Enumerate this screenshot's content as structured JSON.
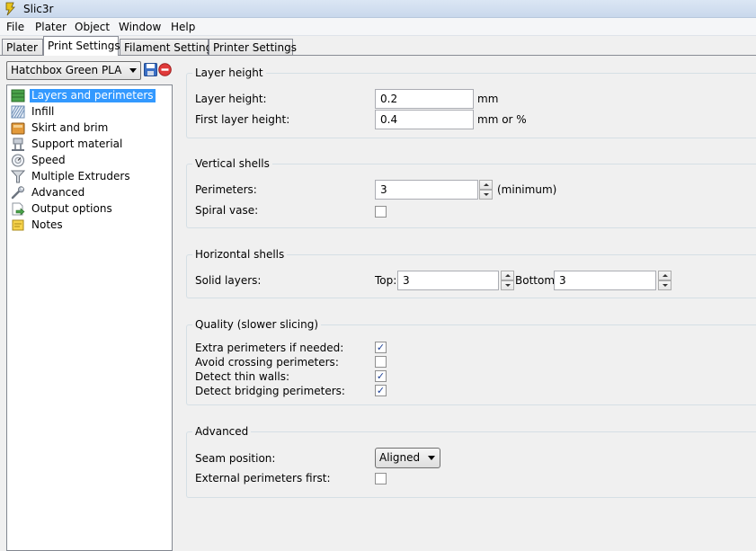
{
  "window": {
    "title": "Slic3r"
  },
  "menu": [
    "File",
    "Plater",
    "Object",
    "Window",
    "Help"
  ],
  "tabs": [
    "Plater",
    "Print Settings",
    "Filament Settings",
    "Printer Settings"
  ],
  "active_tab": "Print Settings",
  "preset": {
    "selected": "Hatchbox Green PLA"
  },
  "tree": {
    "items": [
      {
        "label": "Layers and perimeters",
        "icon": "layers-icon"
      },
      {
        "label": "Infill",
        "icon": "infill-icon"
      },
      {
        "label": "Skirt and brim",
        "icon": "skirt-icon"
      },
      {
        "label": "Support material",
        "icon": "support-icon"
      },
      {
        "label": "Speed",
        "icon": "speed-icon"
      },
      {
        "label": "Multiple Extruders",
        "icon": "funnel-icon"
      },
      {
        "label": "Advanced",
        "icon": "wrench-icon"
      },
      {
        "label": "Output options",
        "icon": "output-icon"
      },
      {
        "label": "Notes",
        "icon": "notes-icon"
      }
    ],
    "selected": "Layers and perimeters"
  },
  "layer_height": {
    "title": "Layer height",
    "layer_height_label": "Layer height:",
    "layer_height_value": "0.2",
    "layer_height_unit": "mm",
    "first_layer_label": "First layer height:",
    "first_layer_value": "0.4",
    "first_layer_unit": "mm or %"
  },
  "vertical_shells": {
    "title": "Vertical shells",
    "perimeters_label": "Perimeters:",
    "perimeters_value": "3",
    "perimeters_hint": "(minimum)",
    "spiral_label": "Spiral vase:",
    "spiral_checked": false
  },
  "horizontal_shells": {
    "title": "Horizontal shells",
    "solid_label": "Solid layers:",
    "top_label": "Top:",
    "top_value": "3",
    "bottom_label": "Bottom:",
    "bottom_value": "3"
  },
  "quality": {
    "title": "Quality (slower slicing)",
    "items": [
      {
        "label": "Extra perimeters if needed:",
        "checked": true
      },
      {
        "label": "Avoid crossing perimeters:",
        "checked": false
      },
      {
        "label": "Detect thin walls:",
        "checked": true
      },
      {
        "label": "Detect bridging perimeters:",
        "checked": true
      }
    ]
  },
  "advanced": {
    "title": "Advanced",
    "seam_label": "Seam position:",
    "seam_value": "Aligned",
    "external_label": "External perimeters first:",
    "external_checked": false
  },
  "check_glyph": "✓"
}
